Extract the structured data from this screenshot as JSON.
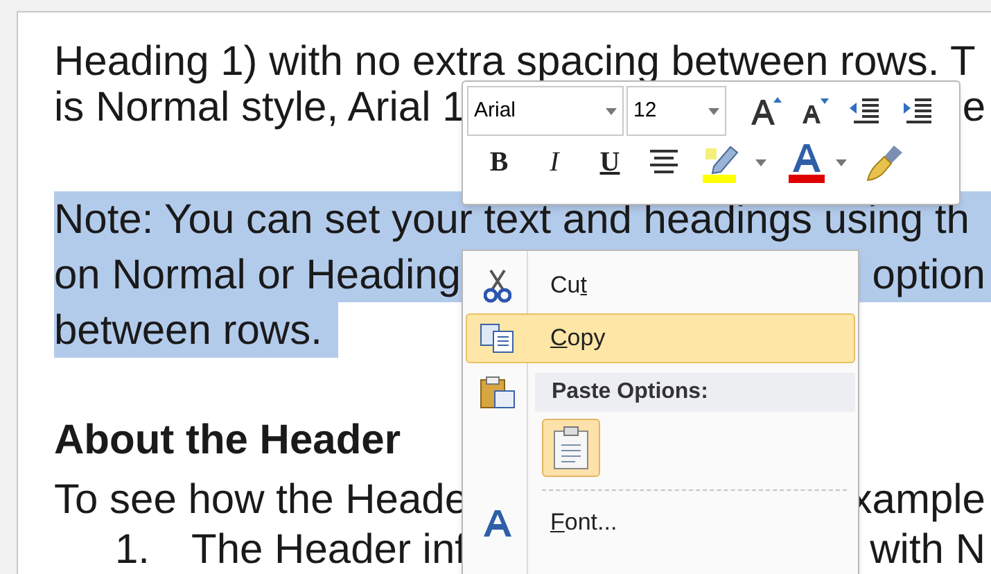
{
  "document": {
    "paragraphs": [
      {
        "kind": "body",
        "selected": false,
        "lines": [
          {
            "left": "Heading 1) with no extra spacing between rows. T"
          },
          {
            "left": "is Normal style, Arial 1",
            "right": "e"
          }
        ]
      },
      {
        "kind": "body",
        "selected": true,
        "lines": [
          {
            "left": "Note: You can set your text and headings using th"
          },
          {
            "left": "on Normal or Heading",
            "right": "option"
          },
          {
            "left": "between rows."
          }
        ]
      },
      {
        "kind": "heading",
        "selected": false,
        "lines": [
          {
            "left": "About the Header"
          }
        ]
      },
      {
        "kind": "body",
        "selected": false,
        "lines": [
          {
            "left": "To see how the Heade",
            "right": "xample"
          }
        ]
      },
      {
        "kind": "list",
        "selected": false,
        "lines": [
          {
            "number": "1.",
            "left": "The Header inf",
            "right": "with N"
          }
        ]
      }
    ]
  },
  "mini_toolbar": {
    "font": "Arial",
    "size": "12",
    "format_buttons": [
      {
        "kind": "bold",
        "label": "B"
      },
      {
        "kind": "italic",
        "label": "I"
      },
      {
        "kind": "underline",
        "label": "U"
      }
    ]
  },
  "context_menu": {
    "items": [
      {
        "kind": "command",
        "pre": "Cu",
        "key": "t",
        "selected": false
      },
      {
        "kind": "command",
        "key": "C",
        "post": "opy",
        "selected": true
      },
      {
        "kind": "header",
        "label": "Paste Options:"
      },
      {
        "kind": "paste_option"
      },
      {
        "kind": "separator"
      },
      {
        "kind": "command",
        "key": "F",
        "post": "ont...",
        "selected": false
      }
    ]
  }
}
